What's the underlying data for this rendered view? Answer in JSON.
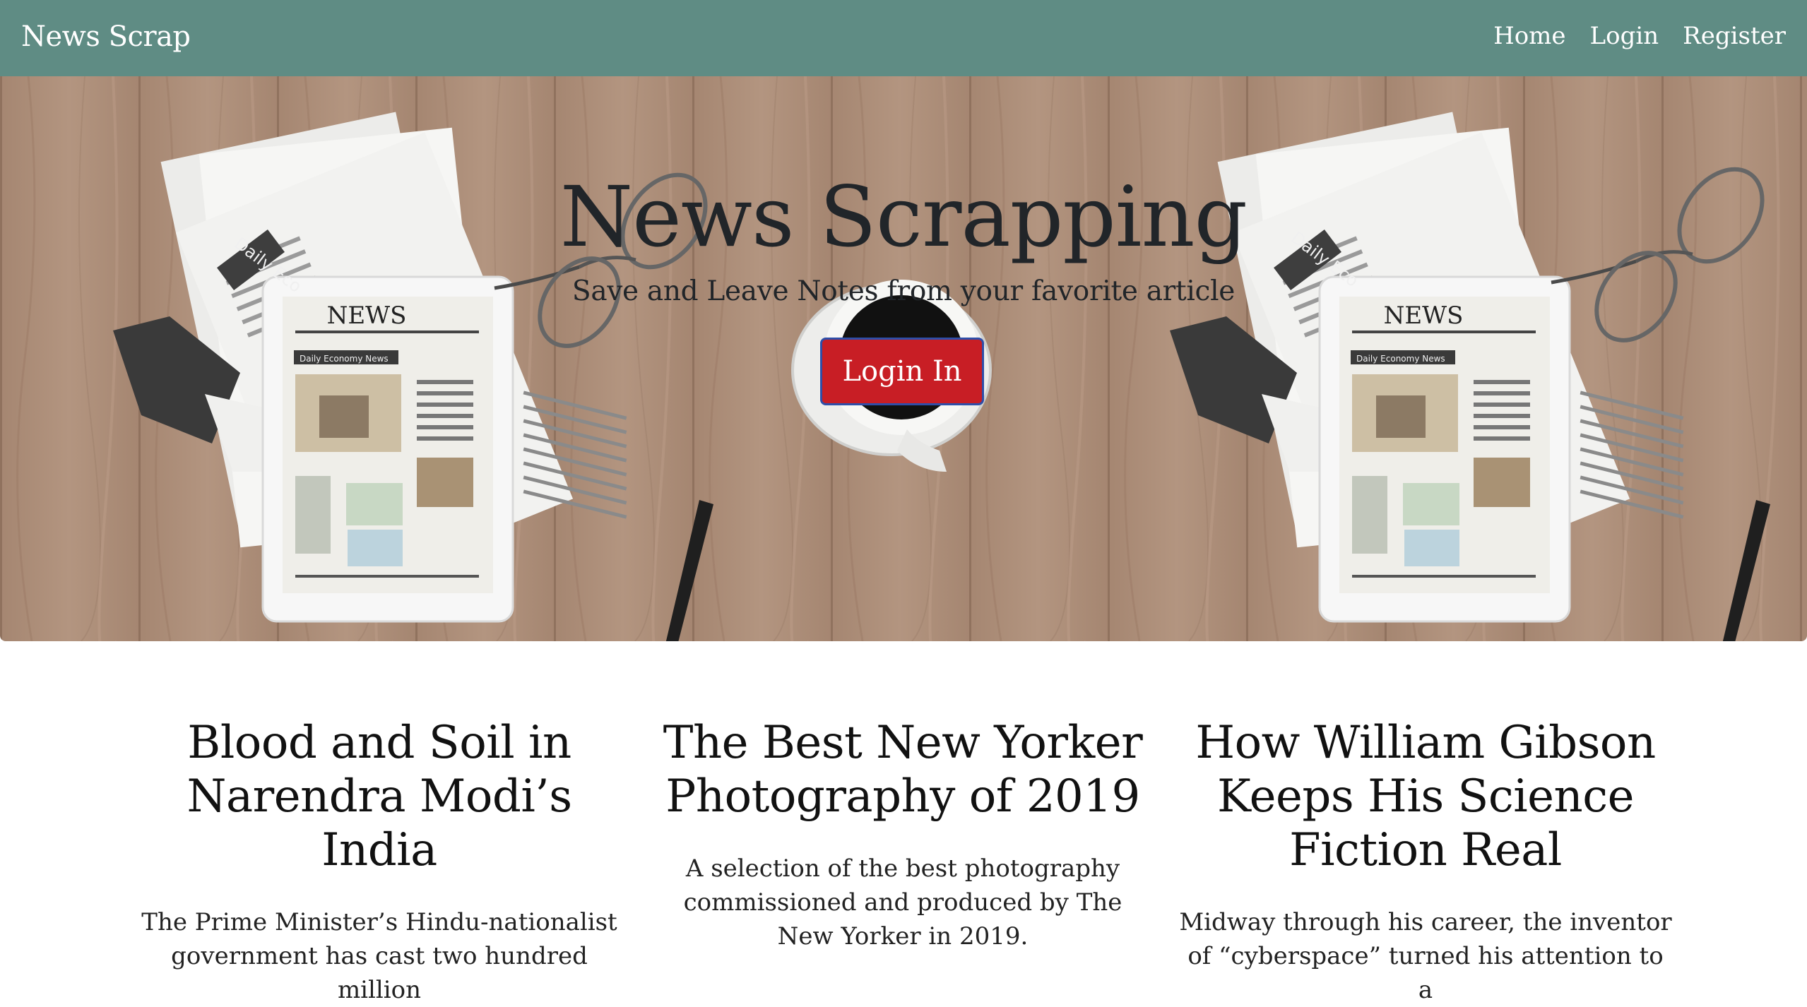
{
  "navbar": {
    "brand": "News Scrap",
    "links": [
      {
        "label": "Home"
      },
      {
        "label": "Login"
      },
      {
        "label": "Register"
      }
    ],
    "bg_color": "#5f8c84"
  },
  "hero": {
    "title": "News Scrapping",
    "subtitle": "Save and Leave Notes from your favorite article",
    "button_label": "Login In",
    "button_color": "#c81e25",
    "newspaper_masthead": "NEWS",
    "newspaper_header": "Daily Economy News",
    "newspaper_side_label": "Daily Eco"
  },
  "articles": [
    {
      "title": "Blood and Soil in Narendra Modi’s India",
      "summary": "The Prime Minister’s Hindu-nationalist government has cast two hundred million"
    },
    {
      "title": "The Best New Yorker Photography of 2019",
      "summary": "A selection of the best photography commissioned and produced by The New Yorker in 2019."
    },
    {
      "title": "How William Gibson Keeps His Science Fiction Real",
      "summary": "Midway through his career, the inventor of “cyberspace” turned his attention to a"
    }
  ]
}
